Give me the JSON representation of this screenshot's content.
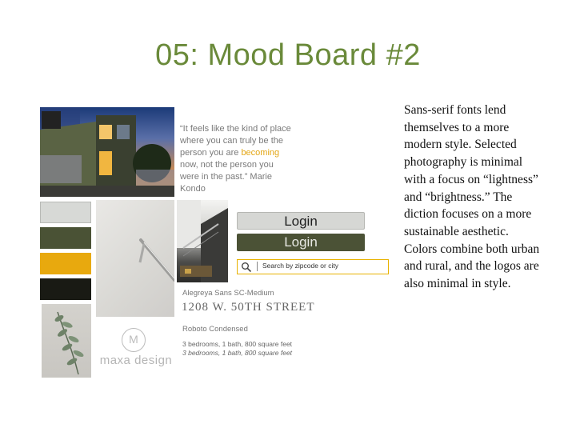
{
  "slide": {
    "title": "05: Mood Board #2",
    "quote": {
      "before": "“It feels like the kind of place where you can truly be the person you are ",
      "highlight": "becoming",
      "after": " now, not the person you were in the past.” Marie Kondo"
    },
    "login_light_label": "Login",
    "login_dark_label": "Login",
    "search": {
      "placeholder": "Search by zipcode or city",
      "icon": "search-icon"
    },
    "font_sample_1": "Alegreya Sans SC-Medium",
    "address": "1208 W. 50TH STREET",
    "font_sample_2": "Roboto Condensed",
    "details_regular": "3 bedrooms, 1 bath, 800 square feet",
    "details_italic": "3 bedrooms, 1 bath, 800 square feet",
    "logo_mark": "M",
    "logo_text": "maxa design",
    "description": "Sans-serif fonts lend themselves to a more modern style. Selected photography is minimal with a focus on “lightness” and “brightness.” The diction focuses on a more sustainable aesthetic.  Colors combine both urban and rural, and the logos are also minimal in style.",
    "swatches": [
      "#d7d9d6",
      "#4a5235",
      "#e8a90e",
      "#191a14"
    ],
    "title_color": "#6a8a3a",
    "highlight_color": "#e3a614"
  }
}
